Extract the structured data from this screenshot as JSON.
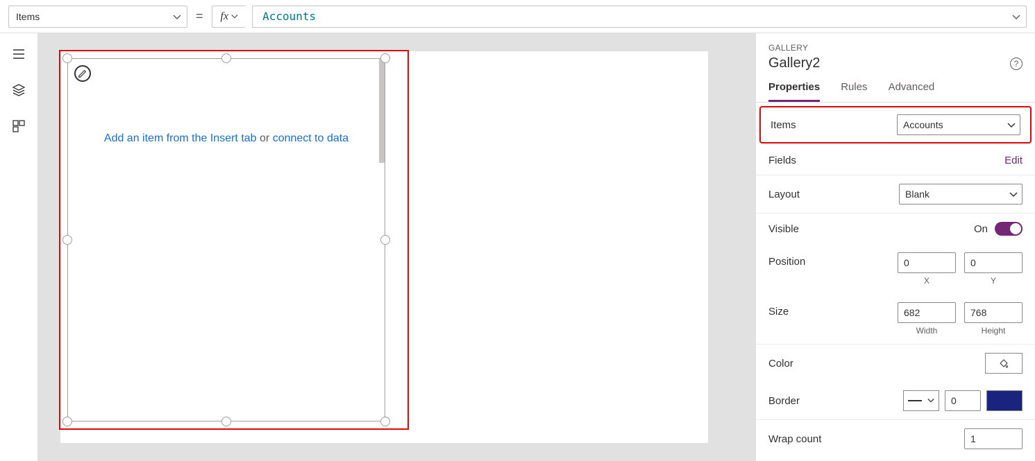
{
  "formulaBar": {
    "property": "Items",
    "fxLabel": "fx",
    "formula": "Accounts"
  },
  "canvas": {
    "hintPrefixLink": "Add an item from the Insert tab",
    "hintMiddle": " or ",
    "hintSuffixLink": "connect to data"
  },
  "panel": {
    "category": "GALLERY",
    "name": "Gallery2",
    "tabs": [
      "Properties",
      "Rules",
      "Advanced"
    ],
    "items": {
      "label": "Items",
      "value": "Accounts"
    },
    "fields": {
      "label": "Fields",
      "editLabel": "Edit"
    },
    "layout": {
      "label": "Layout",
      "value": "Blank"
    },
    "visible": {
      "label": "Visible",
      "state": "On"
    },
    "position": {
      "label": "Position",
      "x": "0",
      "y": "0",
      "xLabel": "X",
      "yLabel": "Y"
    },
    "size": {
      "label": "Size",
      "w": "682",
      "h": "768",
      "wLabel": "Width",
      "hLabel": "Height"
    },
    "color": {
      "label": "Color"
    },
    "border": {
      "label": "Border",
      "width": "0",
      "colorHex": "#1a237e"
    },
    "wrap": {
      "label": "Wrap count",
      "value": "1"
    }
  }
}
